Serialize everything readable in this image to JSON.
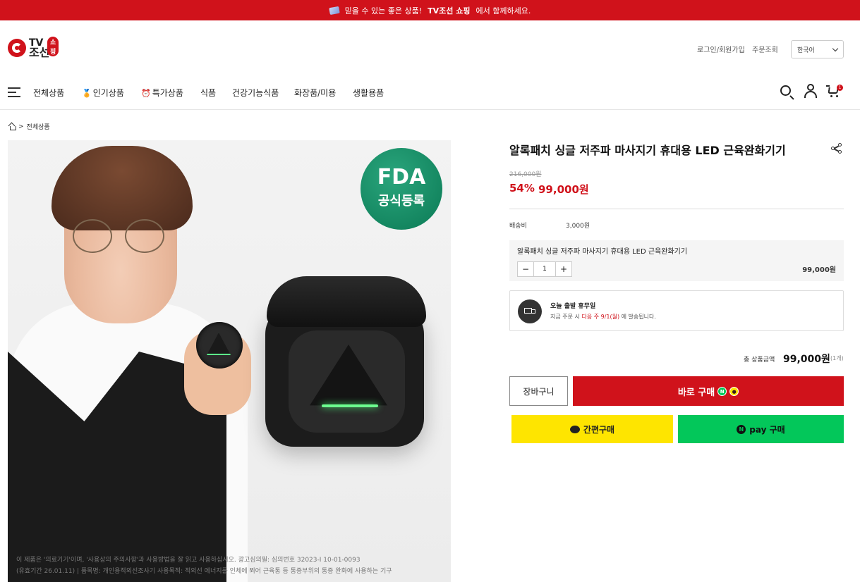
{
  "banner": {
    "text_before": "믿을 수 있는 좋은 상품!",
    "brand": "TV조선 쇼핑",
    "text_after": "에서 함께하세요."
  },
  "header": {
    "logo_line1": "TV",
    "logo_line2": "조선",
    "logo_badge": "쇼핑",
    "login": "로그인/회원가입",
    "order_lookup": "주문조회",
    "language": "한국어"
  },
  "nav": {
    "items": [
      {
        "label": "전체상품",
        "icon": ""
      },
      {
        "label": "인기상품",
        "icon": "🏅"
      },
      {
        "label": "특가상품",
        "icon": "⏰"
      },
      {
        "label": "식품",
        "icon": ""
      },
      {
        "label": "건강기능식품",
        "icon": ""
      },
      {
        "label": "화장품/미용",
        "icon": ""
      },
      {
        "label": "생활용품",
        "icon": ""
      }
    ],
    "cart_count": "1"
  },
  "breadcrumb": {
    "separator": ">",
    "current": "전체상품"
  },
  "product_image": {
    "badge_line1": "FDA",
    "badge_line2": "공식등록",
    "disclaimer_line1": "이 제품은 '의료기기'이며, '사용상의 주의사항'과 사용방법을 잘 읽고 사용하십시오. 광고심의필: 심의번호 32023-I 10-01-0093",
    "disclaimer_line2": "(유효기간 26.01.11) | 품목명: 개인용적외선조사기 사용목적: 적외선 에너지를 인체에 쬐어 근육통 등 통증부위의 통증 완화에 사용하는 기구"
  },
  "product": {
    "title": "알록패치 싱글 저주파 마사지기 휴대용 LED 근육완화기기",
    "original_price": "216,000원",
    "discount": "54%",
    "sale_price": "99,000원",
    "shipping_label": "배송비",
    "shipping_value": "3,000원"
  },
  "option": {
    "name": "알록패치 싱글 저주파 마사지기 휴대용 LED 근육완화기기",
    "minus": "−",
    "quantity": "1",
    "plus": "+",
    "price": "99,000원"
  },
  "delivery": {
    "title": "오늘 출발 휴무일",
    "sub_before": "지금 주문 시",
    "sub_highlight": "다음 주 9/1(월)",
    "sub_after": "에 발송됩니다."
  },
  "total": {
    "label": "총 상품금액",
    "value": "99,000원",
    "count": "(1개)"
  },
  "buttons": {
    "cart": "장바구니",
    "buy": "바로 구매",
    "buy_badge_n": "N",
    "buy_badge_k": "●",
    "kakao": "간편구매",
    "naver_n": "N",
    "naver": "pay 구매"
  },
  "colors": {
    "brand_red": "#d0121b",
    "kakao_yellow": "#fee500",
    "naver_green": "#03c75a"
  }
}
